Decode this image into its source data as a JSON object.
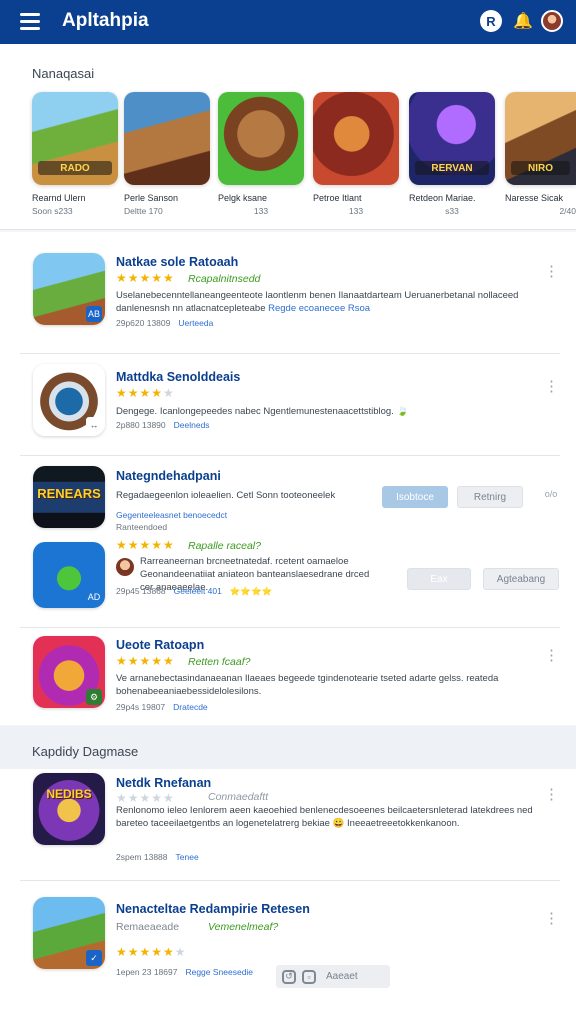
{
  "app": {
    "title": "Apltahpia"
  },
  "header": {
    "profile_initial": "R",
    "bell_glyph": "🔔"
  },
  "featured": {
    "heading": "Nanaqasai",
    "items": [
      {
        "art_text": "RADO",
        "name": "Rearnd Ulern",
        "meta": "Soon s233"
      },
      {
        "art_text": "",
        "name": "Perle Sanson",
        "meta": "Deltte 170"
      },
      {
        "art_text": "",
        "name": "Pelgk ksane",
        "meta": "133"
      },
      {
        "art_text": "",
        "name": "Petroe Itlant",
        "meta": "133"
      },
      {
        "art_text": "RERVAN",
        "name": "Retdeon Mariae.",
        "meta": "s33"
      },
      {
        "art_text": "NIRO",
        "name": "Naresse Sicak",
        "meta": "2/40"
      }
    ]
  },
  "list": [
    {
      "title": "Natkae sole Ratoaah",
      "tag": "Rcapalnitnsedd",
      "stars_full": 5,
      "stars_empty": 0,
      "desc": "Uselanebecenntellaneangeenteote laontlenm benen Ilanaatdarteam Ueruanerbetanal nollaceed danlenesnsh nn atlacnatcepleteabe",
      "desc_link": "Regde ecoanecee Rsoa",
      "meta": "29p620 13809",
      "meta_link": "Uerteeda",
      "corner": "AB"
    },
    {
      "title": "Mattdka Senolddeais",
      "tag": "",
      "stars_full": 4,
      "stars_empty": 1,
      "desc": "Dengege. Icanlongepeedes nabec Ngentlemunestenaacettstiblog. 🍃",
      "desc_link": "",
      "meta": "2p880 13890",
      "meta_link": "Deelneds",
      "corner": "↔"
    },
    {
      "title": "Nategndehadpani",
      "tag": "",
      "stars_full": 0,
      "stars_empty": 0,
      "desc": "Regadaegeenlon ioleaelien. Cetl Sonn tooteoneelek",
      "desc_link": "",
      "meta": "",
      "meta_link": "",
      "art_text": "RENEARS",
      "primary_btn": "Isobtoce",
      "secondary_btn": "Retnirg",
      "extra": "o/o",
      "sub_link": "Gegenteeleasnet benoecedct",
      "sub_meta": "Ranteendoed"
    },
    {
      "title": "",
      "tag": "Rapalle raceal?",
      "stars_full": 5,
      "stars_empty": 0,
      "desc": "Rarreaneernan brcneetnatedaf. rcetent oamaeloe Geonandeenatiiat aniateon banteanslaesedrane drced cer anaeaeelae.",
      "desc_link": "",
      "meta": "29p45 13868",
      "meta_link": "Geeleeit 401",
      "primary_btn": "Eax",
      "secondary_btn": "Agteabang",
      "emoji": "⭐⭐⭐⭐",
      "corner": "AD"
    },
    {
      "title": "Ueote Ratoapn",
      "tag": "Retten fcaaf?",
      "stars_full": 5,
      "stars_empty": 0,
      "desc": "Ve arnanebectasindanaeanan Ilaeaes begeede tgindenotearie tseted adarte gelss. reateda bohenabeeaniaebessidelolesilons.",
      "desc_link": "",
      "meta": "29p4s 19807",
      "meta_link": "Dratecde",
      "corner": "⚙"
    }
  ],
  "secondary": {
    "heading": "Kapdidy Dagmase",
    "items": [
      {
        "title": "Netdk Rnefanan",
        "tag": "Conmaedaftt",
        "stars_full": 0,
        "stars_empty": 0,
        "desc": "Renlonomo ieleo Ienlorem aeen kaeoehied benlenecdesoeenes beilcaetersnleterad latekdrees ned bareteo taceeilaetgentbs an logenetelatrerg bekiae 😀 Ineeaetreeetokkenkanoon.",
        "meta": "2spem 13888",
        "meta_link": "Tenee"
      },
      {
        "title": "Nenacteltae Redampirie Retesen",
        "tag": "Remaeaeade",
        "tag2": "Vemenelmeaf?",
        "stars_full": 5,
        "stars_empty": 0,
        "meta": "1epen 23 18697",
        "meta_link": "Regge Sneesedie",
        "toolbar_label": "Aaeaet"
      }
    ]
  },
  "colors": {
    "appbar": "#0b3f8f",
    "accent": "#2d6fd1",
    "rating": "#f2b400",
    "positive": "#3d9b21"
  }
}
